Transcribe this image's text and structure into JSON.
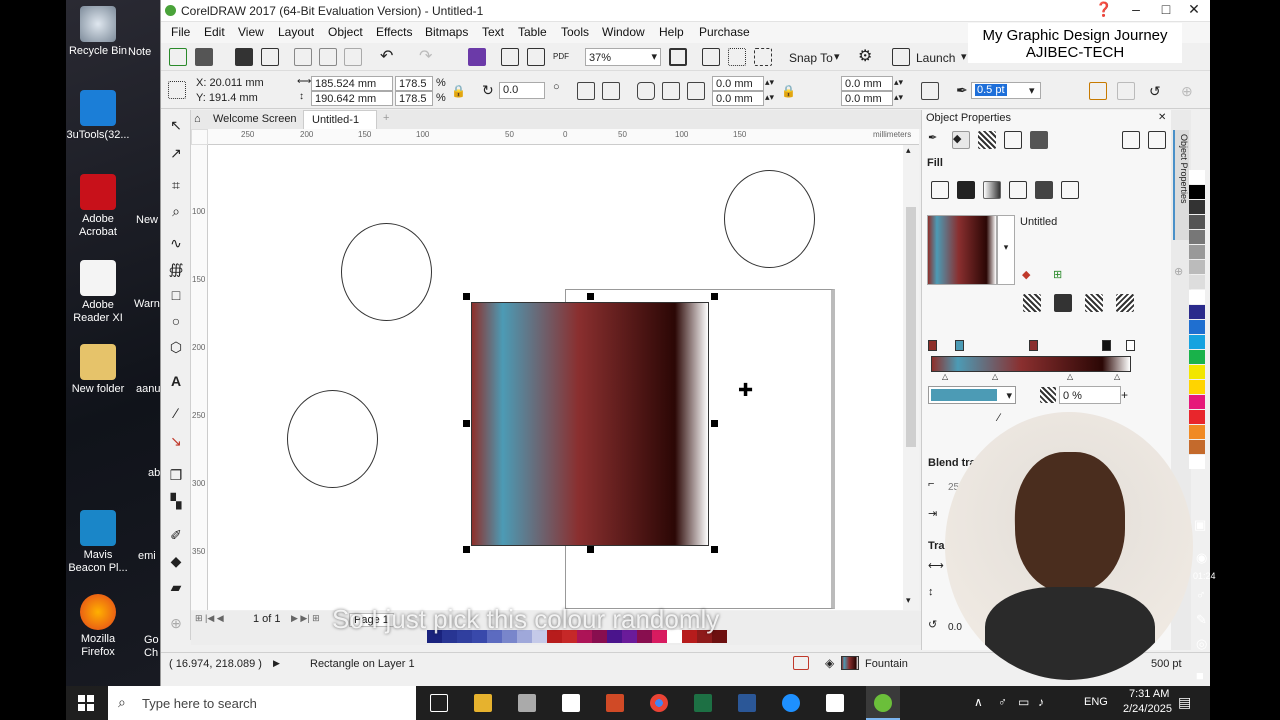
{
  "window": {
    "title": "CorelDRAW 2017 (64-Bit Evaluation Version) - Untitled-1"
  },
  "overlay": {
    "line1": "My Graphic Design Journey",
    "line2": "AJIBEC-TECH",
    "subtitle": "So I just pick this colour randomly"
  },
  "desktop": {
    "icons": [
      "Recycle Bin",
      "Note",
      "3uTools(32...",
      "Adobe Acrobat",
      "New",
      "Adobe Reader XI",
      "Warn",
      "New folder",
      "aanu",
      "ab",
      "Mavis Beacon Pl...",
      "emi",
      "Mozilla Firefox",
      "Go Ch"
    ]
  },
  "menu": [
    "File",
    "Edit",
    "View",
    "Layout",
    "Object",
    "Effects",
    "Bitmaps",
    "Text",
    "Table",
    "Tools",
    "Window",
    "Help",
    "Purchase"
  ],
  "standard": {
    "zoom": "37%",
    "snap": "Snap To",
    "launch": "Launch"
  },
  "props": {
    "x": "X: 20.011 mm",
    "y": "Y: 191.4 mm",
    "w": "185.524 mm",
    "h": "190.642 mm",
    "sx": "178.5",
    "sy": "178.5",
    "pct": "%",
    "angle": "0.0",
    "c1": "0.0 mm",
    "c2": "0.0 mm",
    "c3": "0.0 mm",
    "c4": "0.0 mm",
    "outline": "0.5 pt"
  },
  "tabs": {
    "welcome": "Welcome Screen",
    "doc": "Untitled-1"
  },
  "ruler": {
    "unit": "millimeters",
    "h": [
      "250",
      "200",
      "150",
      "100",
      "50",
      "0",
      "50",
      "100",
      "150"
    ],
    "v": [
      "100",
      "150",
      "200",
      "250",
      "300",
      "350"
    ]
  },
  "docker": {
    "title": "Object Properties",
    "fill": "Fill",
    "preset": "Untitled",
    "opacity": "0 %",
    "blend": "Blend tra",
    "b1": "25",
    "b2": "Tra",
    "b3": "0.0",
    "vtab": "Object Properties"
  },
  "pagebar": {
    "pages": "1 of 1",
    "page": "Page 1"
  },
  "status": {
    "coords": "( 16.974, 218.089 )",
    "object": "Rectangle on Layer 1",
    "fill": "Fountain",
    "outline": "500 pt"
  },
  "taskbar": {
    "search": "Type here to search",
    "lang": "ENG",
    "time": "7:31 AM",
    "date": "2/24/2025"
  },
  "sideTime": "01:24",
  "colors": {
    "grad": [
      "#8e2f2a",
      "#4c9bb5",
      "#8a2f2f",
      "#2b0705",
      "#ffffff"
    ],
    "accent": "#1e6fd9"
  }
}
